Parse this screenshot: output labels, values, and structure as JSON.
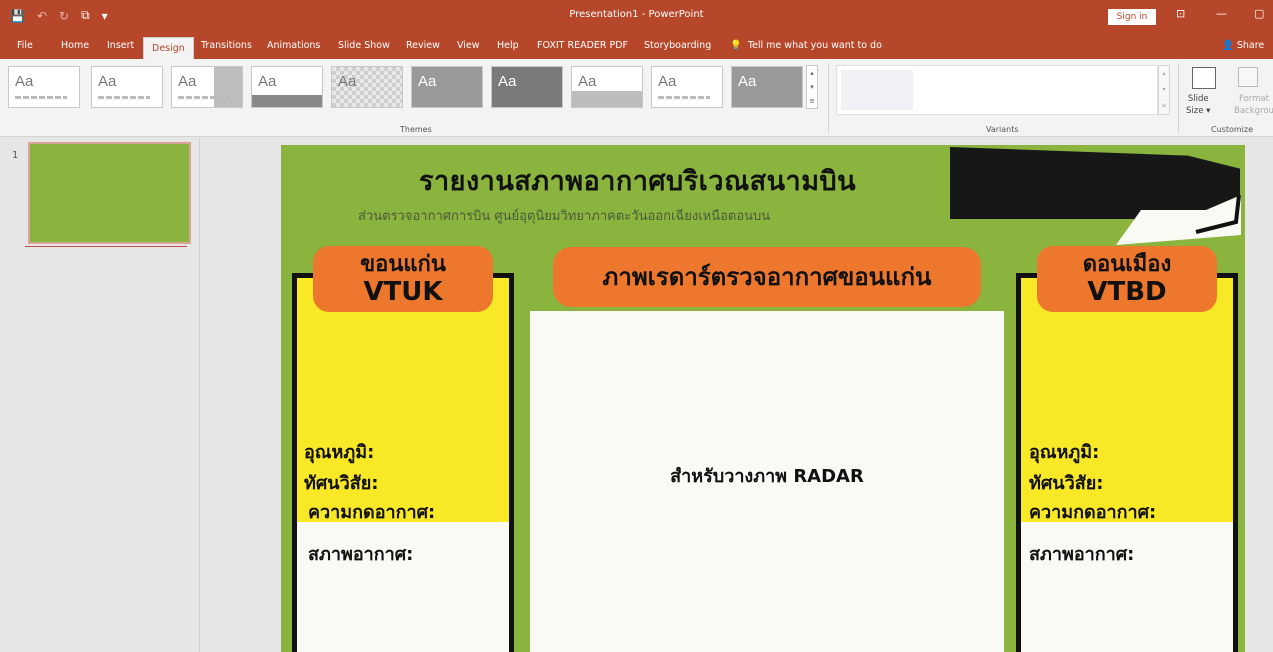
{
  "titlebar": {
    "qat": [
      "💾",
      "↶",
      "↻",
      "⧉",
      "▾"
    ],
    "window_title": "Presentation1 - PowerPoint",
    "signin": "Sign in",
    "ribbon_display": "⊡",
    "minimize": "—",
    "restore": "▢"
  },
  "tabs": [
    "File",
    "Home",
    "Insert",
    "Design",
    "Transitions",
    "Animations",
    "Slide Show",
    "Review",
    "View",
    "Help",
    "FOXIT READER PDF",
    "Storyboarding"
  ],
  "active_tab": "Design",
  "tellme": {
    "icon": "lightbulb-icon",
    "text": "Tell me what you want to do"
  },
  "share": "Share",
  "ribbon": {
    "theme_label": "Aa",
    "groups": {
      "themes": "Themes",
      "variants": "Variants",
      "customize": "Customize"
    },
    "slide_size": [
      "Slide",
      "Size ▾"
    ],
    "format_bg": [
      "Format",
      "Backgrou"
    ]
  },
  "thumbnails": {
    "slide_number": "1"
  },
  "slide": {
    "title": "รายงานสภาพอากาศบริเวณสนามบิน",
    "subtitle": "ส่วนตรวจอากาศการบิน ศูนย์อุตุนิยมวิทยาภาคตะวันออกเฉียงเหนือตอนบน",
    "left": {
      "name": "ขอนแก่น",
      "code": "VTUK",
      "temp": "อุณหภูมิ:",
      "vis": "ทัศนวิสัย:",
      "pressure": "ความกดอากาศ:",
      "weather": "สภาพอากาศ:"
    },
    "center": {
      "title": "ภาพเรดาร์ตรวจอากาศขอนแก่น",
      "placeholder": "สำหรับวางภาพ RADAR"
    },
    "right": {
      "name": "ดอนเมือง",
      "code": "VTBD",
      "temp": "อุณหภูมิ:",
      "vis": "ทัศนวิสัย:",
      "pressure": "ความกดอากาศ:",
      "weather": "สภาพอากาศ:"
    }
  },
  "colors": {
    "ppt_red": "#b7472a",
    "slide_green": "#8ab43e",
    "orange": "#ed772d",
    "yellow": "#f9e826"
  }
}
